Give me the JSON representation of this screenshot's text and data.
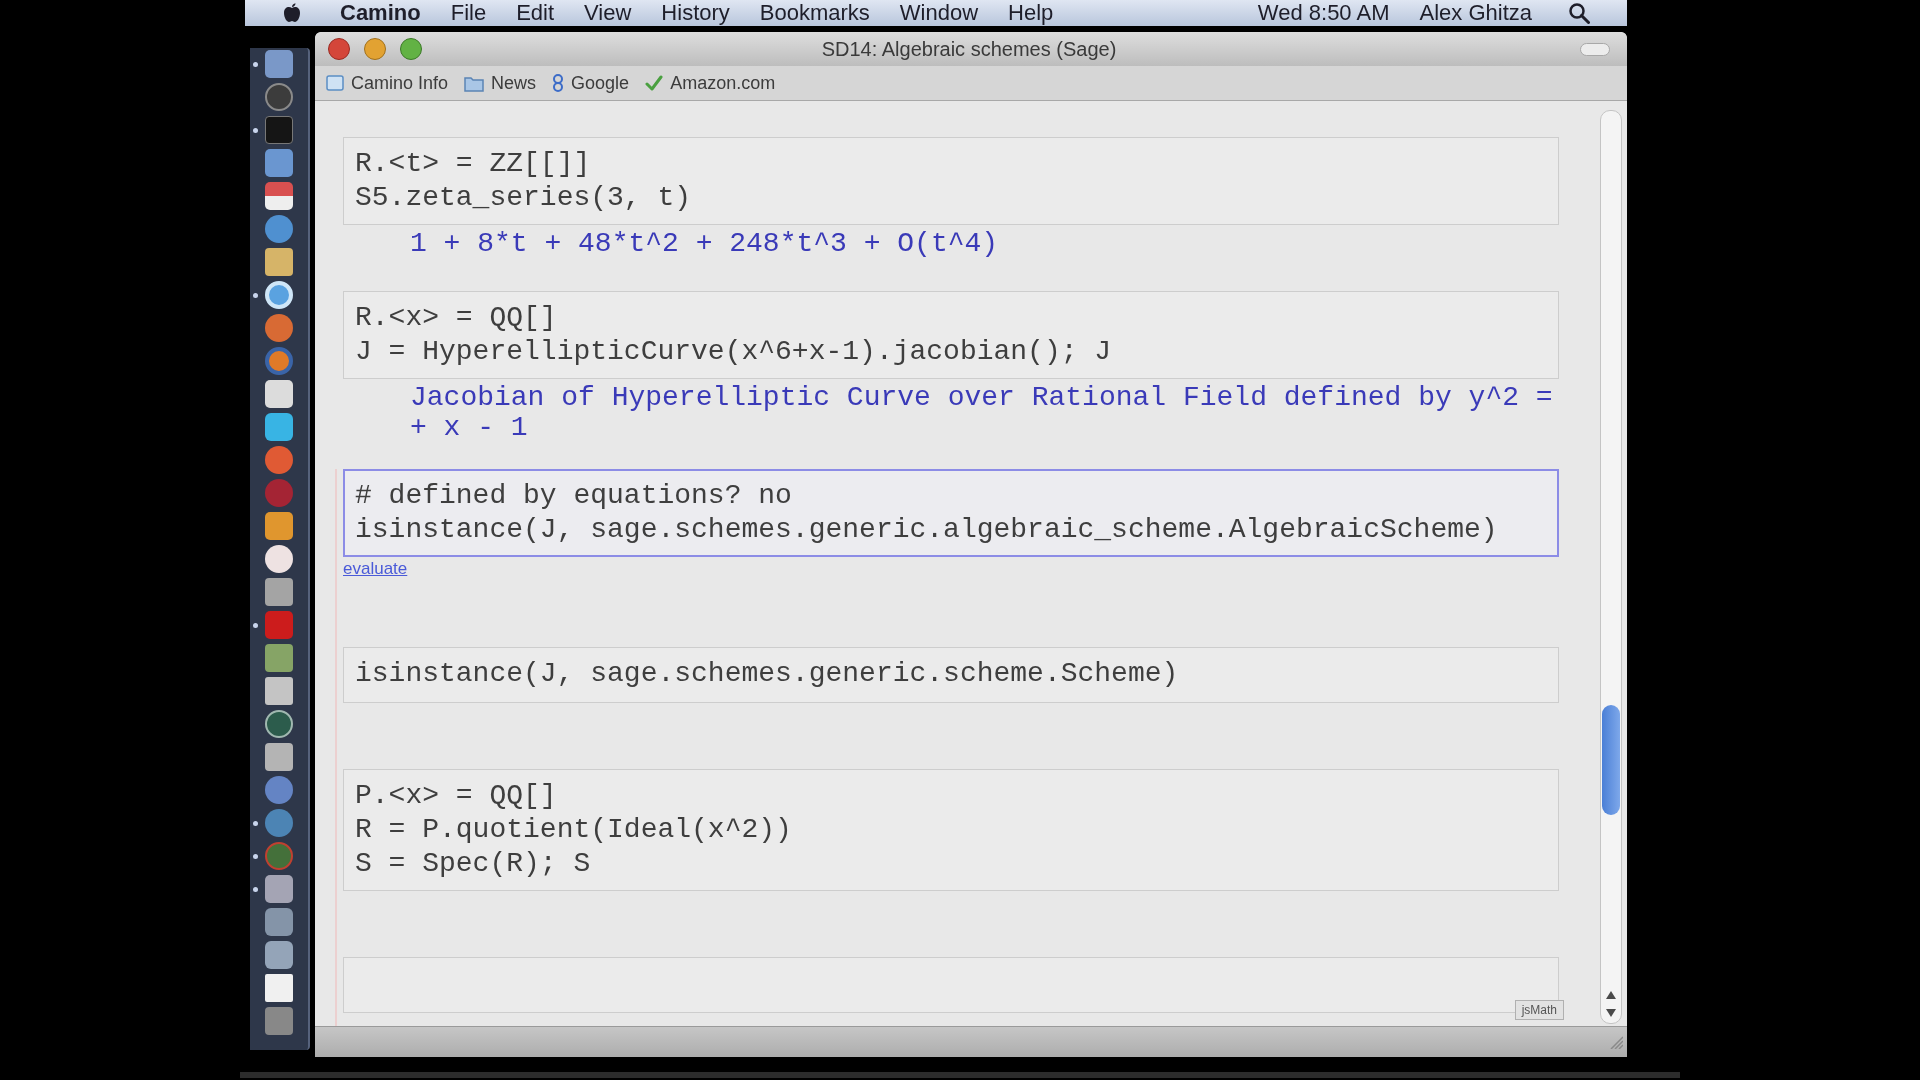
{
  "menu_bar": {
    "app_name": "Camino",
    "menus": [
      "File",
      "Edit",
      "View",
      "History",
      "Bookmarks",
      "Window",
      "Help"
    ],
    "clock": "Wed 8:50 AM",
    "user": "Alex Ghitza"
  },
  "dock": {
    "items": [
      {
        "running": true
      },
      {
        "running": false
      },
      {
        "running": true
      },
      {
        "running": false
      },
      {
        "running": false
      },
      {
        "running": false
      },
      {
        "running": false
      },
      {
        "running": true
      },
      {
        "running": false
      },
      {
        "running": false
      },
      {
        "running": false
      },
      {
        "running": false
      },
      {
        "running": false
      },
      {
        "running": false
      },
      {
        "running": false
      },
      {
        "running": false
      },
      {
        "running": false
      },
      {
        "running": true
      },
      {
        "running": false
      },
      {
        "running": false
      },
      {
        "running": false
      },
      {
        "running": false
      },
      {
        "running": false
      },
      {
        "running": true
      },
      {
        "running": true
      },
      {
        "running": true
      },
      {
        "running": false
      },
      {
        "running": false
      },
      {
        "running": false
      },
      {
        "running": false
      }
    ]
  },
  "window": {
    "title": "SD14: Algebraic schemes (Sage)"
  },
  "bookmarks": [
    "Camino Info",
    "News",
    "Google",
    "Amazon.com"
  ],
  "notebook": {
    "cells": [
      {
        "selected": false,
        "input": [
          "R.<t> = ZZ[[]]",
          "S5.zeta_series(3, t)"
        ],
        "output": [
          "1 + 8*t + 48*t^2 + 248*t^3 + O(t^4)"
        ]
      },
      {
        "selected": false,
        "input": [
          "R.<x> = QQ[]",
          "J = HyperellipticCurve(x^6+x-1).jacobian(); J"
        ],
        "output": [
          "Jacobian of Hyperelliptic Curve over Rational Field defined by y^2 =",
          "+ x - 1"
        ]
      },
      {
        "selected": true,
        "input": [
          "# defined by equations? no",
          "isinstance(J, sage.schemes.generic.algebraic_scheme.AlgebraicScheme)"
        ],
        "evaluate_link": "evaluate"
      },
      {
        "selected": false,
        "input": [
          "isinstance(J, sage.schemes.generic.scheme.Scheme)"
        ]
      },
      {
        "selected": false,
        "input": [
          "P.<x> = QQ[]",
          "R = P.quotient(Ideal(x^2))",
          "S = Spec(R); S"
        ]
      },
      {
        "selected": false
      }
    ],
    "jsmath_button": "jsMath"
  }
}
